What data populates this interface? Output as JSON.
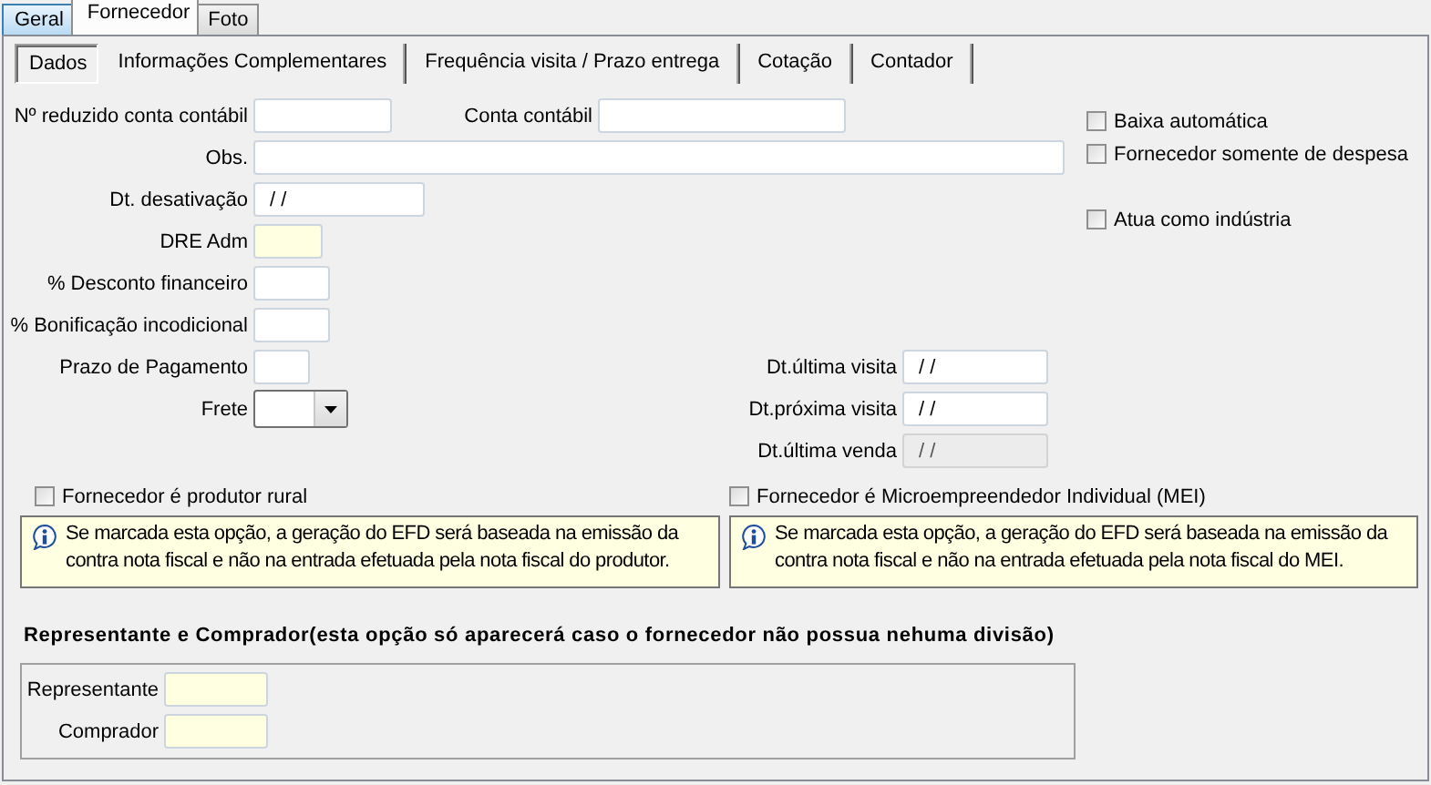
{
  "outer_tabs": [
    {
      "label": "Geral",
      "selected": false,
      "hot": true
    },
    {
      "label": "Fornecedor",
      "selected": true,
      "hot": false
    },
    {
      "label": "Foto",
      "selected": false,
      "hot": false
    }
  ],
  "inner_tabs": [
    {
      "label": "Dados",
      "selected": true
    },
    {
      "label": "Informações Complementares",
      "selected": false
    },
    {
      "label": "Frequência visita / Prazo entrega",
      "selected": false
    },
    {
      "label": "Cotação",
      "selected": false
    },
    {
      "label": "Contador",
      "selected": false
    }
  ],
  "rows": [
    [
      {
        "label": "Nº reduzido conta contábil",
        "kind": "text"
      },
      {
        "label": "Conta contábil",
        "kind": "text"
      }
    ],
    [
      {
        "label": "Obs.",
        "kind": "text"
      }
    ],
    [
      {
        "label": "Dt. desativação",
        "kind": "text",
        "value": "/ /"
      }
    ],
    [
      {
        "label": "DRE Adm",
        "kind": "required"
      }
    ],
    [
      {
        "label": "% Desconto financeiro",
        "kind": "text"
      }
    ],
    [
      {
        "label": "% Bonificação incodicional",
        "kind": "text"
      }
    ],
    [
      {
        "label": "Prazo de Pagamento",
        "kind": "text"
      }
    ],
    [
      {
        "label": "Frete",
        "kind": "combo"
      }
    ]
  ],
  "visit_dates": [
    {
      "label": "Dt.última visita",
      "kind": "text",
      "value": "/ /"
    },
    {
      "label": "Dt.próxima visita",
      "kind": "text",
      "value": "/ /"
    },
    {
      "label": "Dt.última venda",
      "kind": "readonly",
      "value": "/ /"
    }
  ],
  "options": [
    {
      "label": "Baixa automática",
      "checked": false
    },
    {
      "label": "Fornecedor somente de despesa",
      "checked": false
    },
    {
      "label": "Atua como indústria",
      "checked": false
    }
  ],
  "regime_options": [
    {
      "label": "Fornecedor é produtor rural",
      "checked": false,
      "info": "Se marcada esta opção, a geração do EFD será baseada na emissão da contra nota fiscal e não na entrada efetuada pela nota fiscal do produtor."
    },
    {
      "label": "Fornecedor é Microempreendedor Individual (MEI)",
      "checked": false,
      "info": "Se marcada esta opção, a geração do EFD será baseada na emissão da contra nota fiscal e não na entrada efetuada pela nota fiscal do MEI."
    }
  ],
  "representation": {
    "title": "Representante e Comprador(esta opção só aparecerá caso o fornecedor não possua nehuma divisão)",
    "fields": [
      {
        "label": "Representante",
        "kind": "required"
      },
      {
        "label": "Comprador",
        "kind": "required"
      }
    ]
  }
}
